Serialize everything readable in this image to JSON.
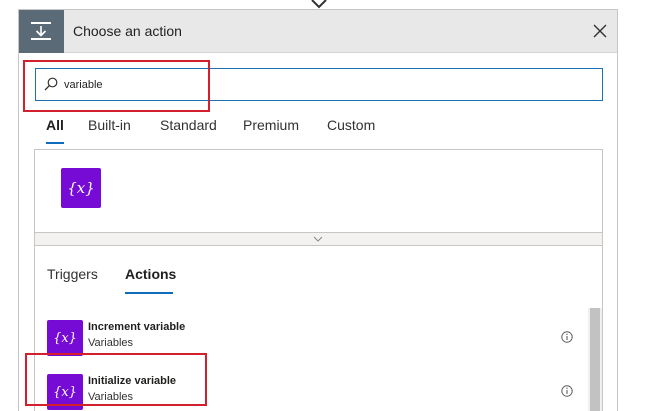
{
  "header": {
    "title": "Choose an action",
    "icon": "step-flow-icon",
    "close_icon": "close-icon"
  },
  "search": {
    "value": "variable",
    "icon": "search-icon"
  },
  "tabs": [
    {
      "label": "All",
      "active": true
    },
    {
      "label": "Built-in",
      "active": false
    },
    {
      "label": "Standard",
      "active": false
    },
    {
      "label": "Premium",
      "active": false
    },
    {
      "label": "Custom",
      "active": false
    }
  ],
  "connector": {
    "glyph": "{x}",
    "color": "#770bd6"
  },
  "sub_tabs": [
    {
      "label": "Triggers",
      "active": false
    },
    {
      "label": "Actions",
      "active": true
    }
  ],
  "actions": [
    {
      "glyph": "{x}",
      "name": "Increment variable",
      "connector": "Variables"
    },
    {
      "glyph": "{x}",
      "name": "Initialize variable",
      "connector": "Variables"
    }
  ],
  "colors": {
    "accent": "#0f6cbd",
    "highlight": "#d4202c",
    "variables_purple": "#770bd6"
  }
}
